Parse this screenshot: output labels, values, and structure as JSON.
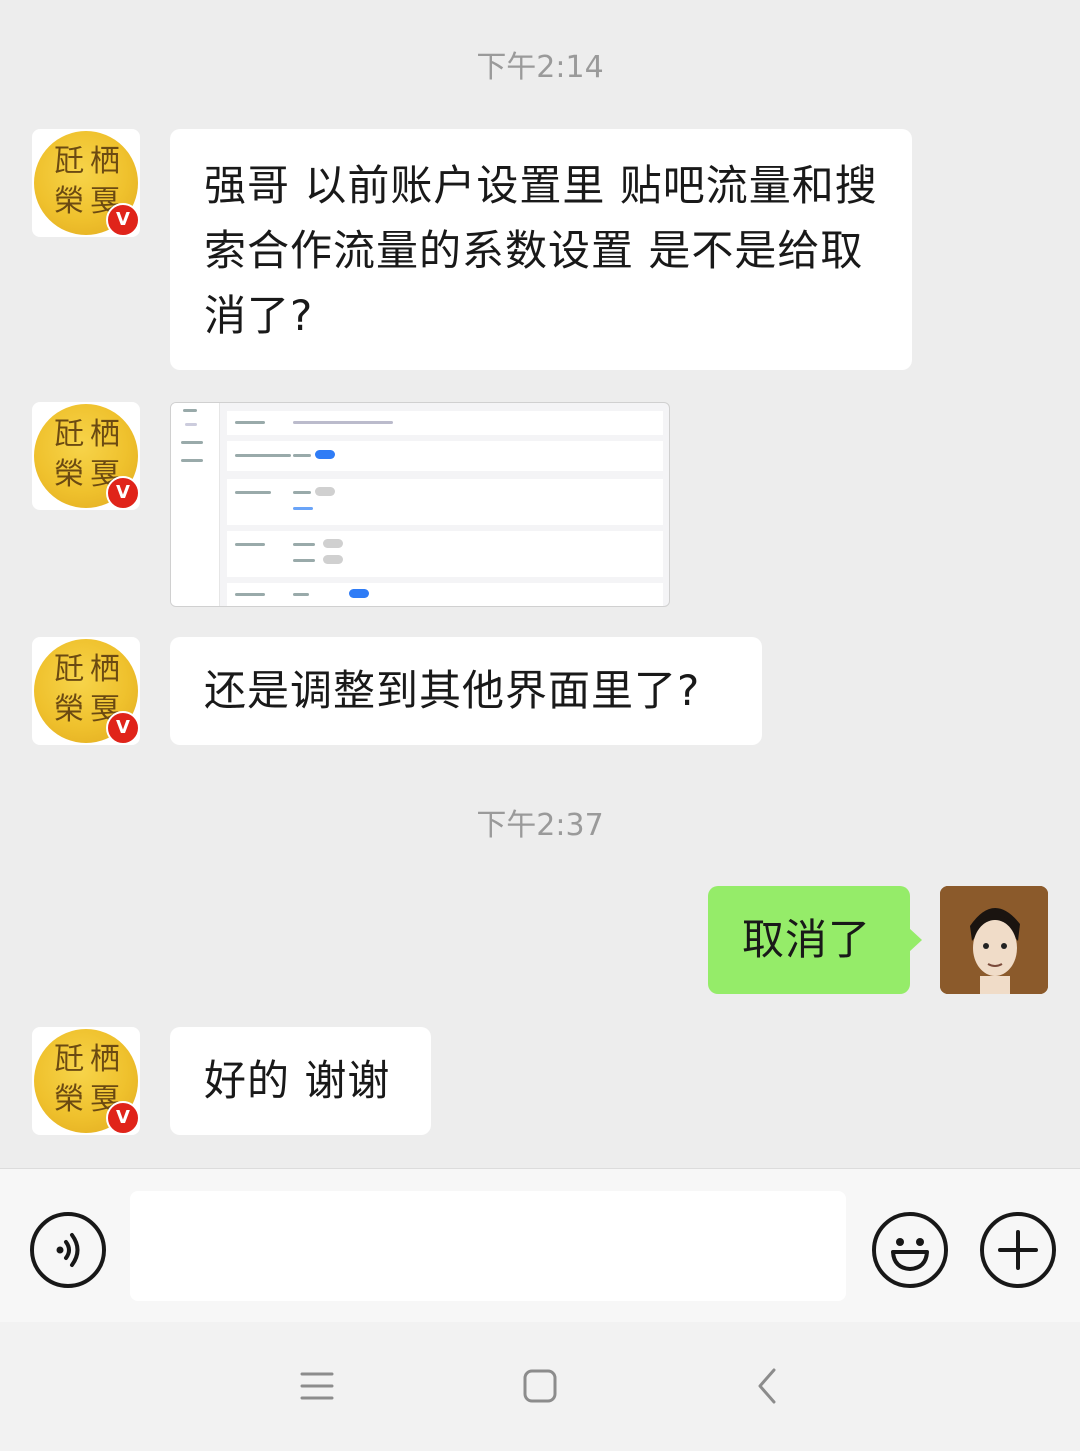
{
  "timestamps": [
    "下午2:14",
    "下午2:37"
  ],
  "contact": {
    "avatar_glyphs": [
      "瓩",
      "栖",
      "榮",
      "戛"
    ],
    "badge": "V"
  },
  "messages": {
    "m1": {
      "text": "强哥 以前账户设置里 贴吧流量和搜索合作流量的系数设置 是不是给取消了?"
    },
    "m2": {
      "type": "image",
      "description_icon": "settings-screenshot-thumbnail"
    },
    "m3": {
      "text": "还是调整到其他界面里了?"
    },
    "m4": {
      "text": "取消了"
    },
    "m5": {
      "text": "好的 谢谢"
    }
  },
  "input_bar": {
    "voice_icon": "voice-icon",
    "emoji_icon": "emoji-icon",
    "more_icon": "plus-icon",
    "value": ""
  },
  "nav": {
    "icons": [
      "menu-icon",
      "home-icon",
      "back-icon"
    ]
  },
  "colors": {
    "background": "#ededed",
    "incoming_bubble": "#ffffff",
    "outgoing_bubble": "#95ec69",
    "timestamp": "#9a9a9a",
    "badge": "#e0241a",
    "toggle_on": "#2f7cf6"
  }
}
